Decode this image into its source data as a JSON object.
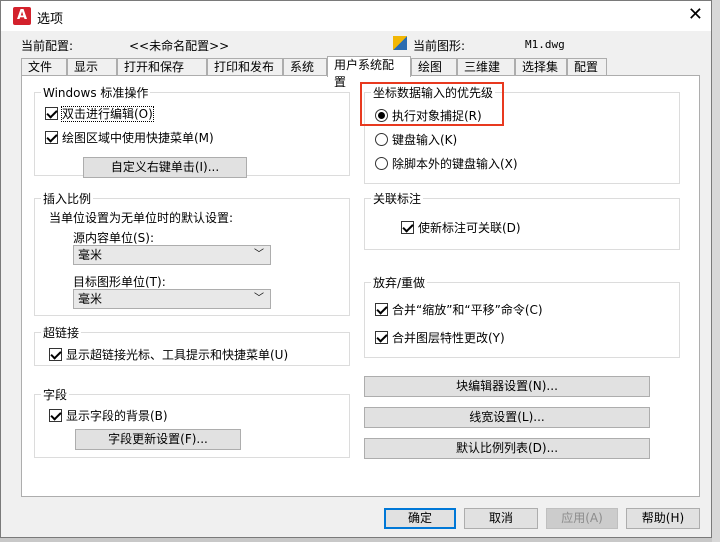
{
  "window": {
    "app_icon_letter": "A",
    "title": "选项",
    "close_symbol": "✕"
  },
  "header": {
    "current_config_label": "当前配置:",
    "current_config_value": "<<未命名配置>>",
    "current_drawing_label": "当前图形:",
    "current_drawing_value": "M1.dwg"
  },
  "tabs": [
    {
      "label": "文件"
    },
    {
      "label": "显示"
    },
    {
      "label": "打开和保存"
    },
    {
      "label": "打印和发布"
    },
    {
      "label": "系统"
    },
    {
      "label": "用户系统配置",
      "active": true
    },
    {
      "label": "绘图"
    },
    {
      "label": "三维建模"
    },
    {
      "label": "选择集"
    },
    {
      "label": "配置"
    }
  ],
  "windows_ops": {
    "title": "Windows 标准操作",
    "double_click_edit": "双击进行编辑(O)",
    "shortcut_menu": "绘图区域中使用快捷菜单(M)",
    "customize_right_click": "自定义右键单击(I)..."
  },
  "insert_scale": {
    "title": "插入比例",
    "desc": "当单位设置为无单位时的默认设置:",
    "source_label": "源内容单位(S):",
    "source_value": "毫米",
    "target_label": "目标图形单位(T):",
    "target_value": "毫米"
  },
  "hyperlink": {
    "title": "超链接",
    "show_cursor": "显示超链接光标、工具提示和快捷菜单(U)"
  },
  "fields": {
    "title": "字段",
    "show_background": "显示字段的背景(B)",
    "update_settings": "字段更新设置(F)..."
  },
  "coord_priority": {
    "title": "坐标数据输入的优先级",
    "option_osnap": "执行对象捕捉(R)",
    "option_keyboard": "键盘输入(K)",
    "option_keyboard_except_script": "除脚本外的键盘输入(X)"
  },
  "assoc_dim": {
    "title": "关联标注",
    "make_new_assoc": "使新标注可关联(D)"
  },
  "undo_redo": {
    "title": "放弃/重做",
    "combine_zoom_pan": "合并“缩放”和“平移”命令(C)",
    "combine_layer": "合并图层特性更改(Y)"
  },
  "right_buttons": {
    "block_editor": "块编辑器设置(N)...",
    "lineweight": "线宽设置(L)...",
    "scale_list": "默认比例列表(D)..."
  },
  "footer": {
    "ok": "确定",
    "cancel": "取消",
    "apply": "应用(A)",
    "help": "帮助(H)"
  }
}
